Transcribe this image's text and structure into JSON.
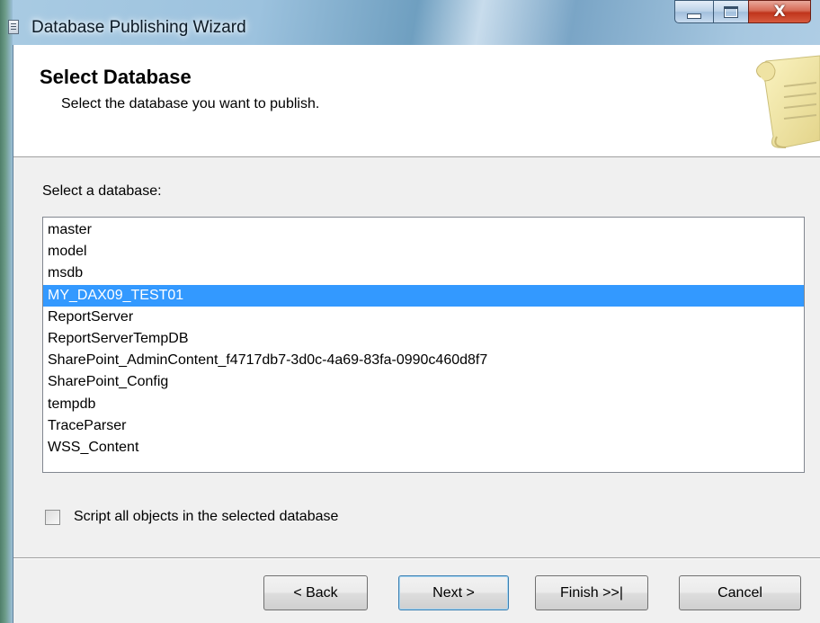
{
  "window": {
    "title": "Database Publishing Wizard",
    "controls": {
      "minimize_icon": "minimize-icon",
      "maximize_icon": "maximize-icon",
      "close_glyph": "X"
    }
  },
  "header": {
    "title": "Select Database",
    "subtitle": "Select the database you want to publish.",
    "graphic_icon": "scroll-icon"
  },
  "database_list": {
    "label": "Select a database:",
    "items": [
      "master",
      "model",
      "msdb",
      "MY_DAX09_TEST01",
      "ReportServer",
      "ReportServerTempDB",
      "SharePoint_AdminContent_f4717db7-3d0c-4a69-83fa-0990c460d8f7",
      "SharePoint_Config",
      "tempdb",
      "TraceParser",
      "WSS_Content"
    ],
    "selected": "MY_DAX09_TEST01"
  },
  "options": {
    "script_all_label": "Script all objects in the selected database",
    "script_all_checked": false
  },
  "buttons": {
    "back": "< Back",
    "next": "Next >",
    "finish": "Finish >>|",
    "cancel": "Cancel"
  },
  "colors": {
    "selection": "#3399ff",
    "close_button": "#c0351c",
    "dialog_background": "#f0f0f0"
  }
}
